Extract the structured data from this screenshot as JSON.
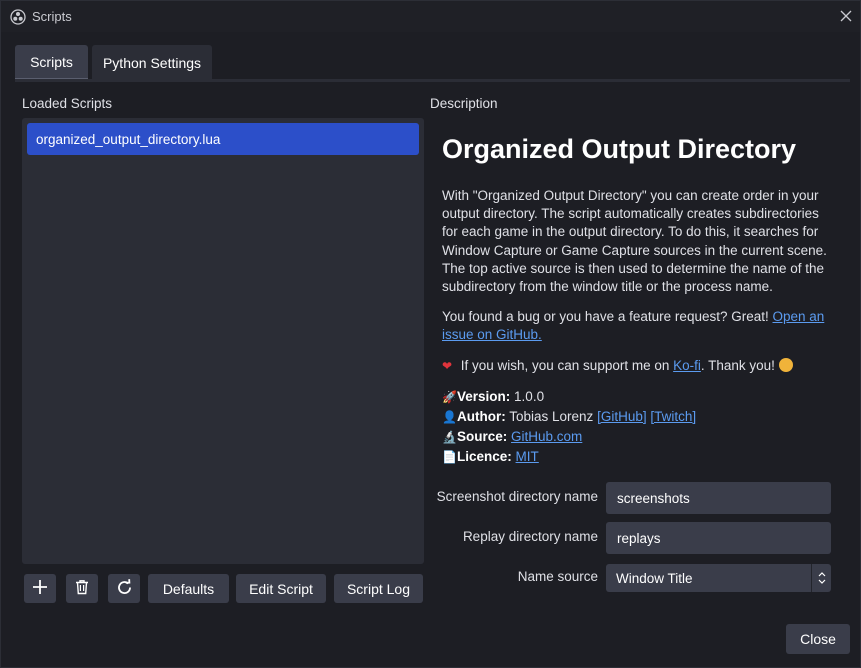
{
  "window": {
    "title": "Scripts"
  },
  "icons": {
    "app": "obs-logo-icon",
    "close": "close-icon",
    "add": "plus-icon",
    "remove": "trash-icon",
    "reload": "reload-icon",
    "select_arrows": "updown-arrows-icon"
  },
  "tabs": [
    {
      "label": "Scripts",
      "active": true
    },
    {
      "label": "Python Settings",
      "active": false
    }
  ],
  "loaded_scripts": {
    "label": "Loaded Scripts",
    "items": [
      "organized_output_directory.lua"
    ]
  },
  "buttons": {
    "defaults": "Defaults",
    "edit_script": "Edit Script",
    "script_log": "Script Log",
    "close": "Close"
  },
  "description": {
    "label": "Description",
    "title": "Organized Output Directory",
    "para1": "With \"Organized Output Directory\" you can create order in your output directory. The script automatically creates subdirectories for each game in the output directory. To do this, it searches for Window Capture or Game Capture sources in the current scene. The top active source is then used to determine the name of the subdirectory from the window title or the process name.",
    "bug_text": "You found a bug or you have a feature request? Great! ",
    "bug_link": "Open an issue on GitHub.",
    "support_pre": " If you wish, you can support me on ",
    "support_link": "Ko-fi",
    "support_post": ". Thank you! ",
    "version_label": "Version:",
    "version_value": "1.0.0",
    "author_label": "Author:",
    "author_value": "Tobias Lorenz",
    "author_link1": "[GitHub]",
    "author_link2": "[Twitch]",
    "source_label": "Source:",
    "source_link": "GitHub.com",
    "licence_label": "Licence:",
    "licence_link": "MIT"
  },
  "settings": {
    "screenshot_label": "Screenshot directory name",
    "screenshot_value": "screenshots",
    "replay_label": "Replay directory name",
    "replay_value": "replays",
    "name_source_label": "Name source",
    "name_source_value": "Window Title"
  },
  "colors": {
    "accent": "#2c4fc9",
    "link": "#5b9bf0",
    "background": "#1d1e24",
    "panel": "#2b2d36",
    "control": "#3a3d4a"
  }
}
